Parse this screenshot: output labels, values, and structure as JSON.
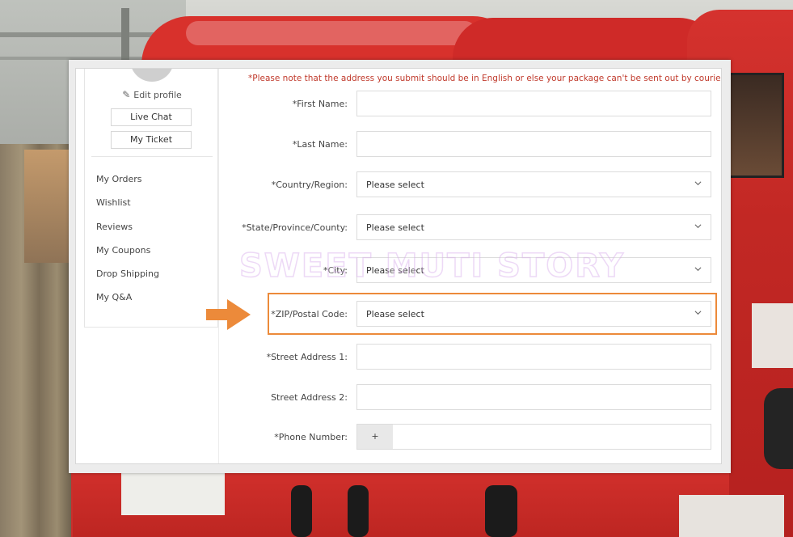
{
  "sidebar": {
    "edit_profile": "Edit profile",
    "live_chat": "Live Chat",
    "my_ticket": "My Ticket",
    "menu": [
      "My Orders",
      "Wishlist",
      "Reviews",
      "My Coupons",
      "Drop Shipping",
      "My Q&A"
    ]
  },
  "form": {
    "note": "*Please note that the address you submit should be in English or else your package can't be sent out by couriers.",
    "first_name": {
      "label": "*First Name:",
      "value": ""
    },
    "last_name": {
      "label": "*Last Name:",
      "value": ""
    },
    "country": {
      "label": "*Country/Region:",
      "selected": "Please select"
    },
    "state": {
      "label": "*State/Province/County:",
      "selected": "Please select"
    },
    "city": {
      "label": "*City:",
      "selected": "Please select"
    },
    "zip": {
      "label": "*ZIP/Postal Code:",
      "selected": "Please select"
    },
    "street1": {
      "label": "*Street Address 1:",
      "value": ""
    },
    "street2": {
      "label": "Street Address 2:",
      "value": ""
    },
    "phone": {
      "label": "*Phone Number:",
      "prefix": "+",
      "value": ""
    }
  },
  "annotation": {
    "highlight_color": "#ec8a3a",
    "target": "zip"
  },
  "watermark": "SWEET MUTI STORY",
  "colors": {
    "note_red": "#c0392b",
    "highlight_orange": "#ec8a3a"
  },
  "icons": {
    "edit": "pencil-icon",
    "dropdown": "chevron-down-icon",
    "pointer": "arrow-right-icon"
  }
}
